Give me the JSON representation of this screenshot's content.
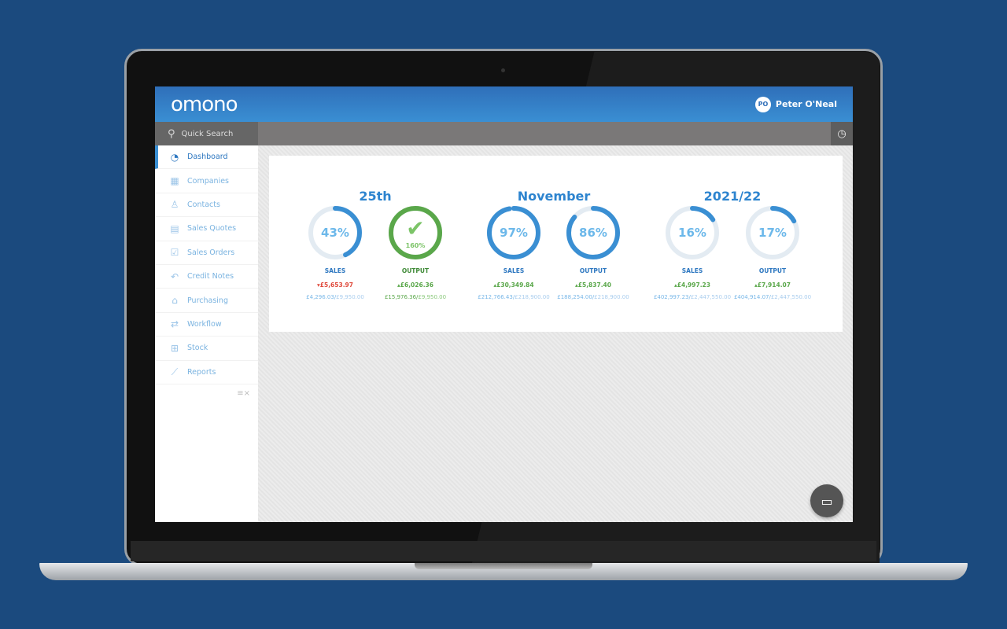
{
  "brand": {
    "logo": "omono"
  },
  "user": {
    "initials": "PO",
    "name": "Peter O'Neal"
  },
  "search": {
    "label": "Quick Search"
  },
  "sidebar": {
    "items": [
      {
        "label": "Dashboard",
        "icon": "◔",
        "active": true
      },
      {
        "label": "Companies",
        "icon": "▦"
      },
      {
        "label": "Contacts",
        "icon": "♙"
      },
      {
        "label": "Sales Quotes",
        "icon": "▤"
      },
      {
        "label": "Sales Orders",
        "icon": "☑"
      },
      {
        "label": "Credit Notes",
        "icon": "↶"
      },
      {
        "label": "Purchasing",
        "icon": "⌂"
      },
      {
        "label": "Workflow",
        "icon": "⇄"
      },
      {
        "label": "Stock",
        "icon": "⊞"
      },
      {
        "label": "Reports",
        "icon": "⟋"
      }
    ]
  },
  "colors": {
    "blue": "#3a8fd3",
    "lightblue": "#6cb8ea",
    "green": "#5aa74a",
    "red": "#e04a3c",
    "track": "#e3ebf2"
  },
  "groups": [
    {
      "title": "25th",
      "gauges": [
        {
          "label": "SALES",
          "percent": 43,
          "display": "43%",
          "delta": "£5,653.97",
          "direction": "down",
          "actual": "£4,296.03",
          "target": "£9,950.00"
        },
        {
          "label": "OUTPUT",
          "percent": 160,
          "display": "160%",
          "complete": true,
          "delta": "£6,026.36",
          "direction": "up",
          "actual": "£15,976.36",
          "target": "£9,950.00"
        }
      ]
    },
    {
      "title": "November",
      "gauges": [
        {
          "label": "SALES",
          "percent": 97,
          "display": "97%",
          "delta": "£30,349.84",
          "direction": "up",
          "actual": "£212,766.43",
          "target": "£218,900.00"
        },
        {
          "label": "OUTPUT",
          "percent": 86,
          "display": "86%",
          "delta": "£5,837.40",
          "direction": "up",
          "actual": "£188,254.00",
          "target": "£218,900.00"
        }
      ]
    },
    {
      "title": "2021/22",
      "gauges": [
        {
          "label": "SALES",
          "percent": 16,
          "display": "16%",
          "delta": "£4,997.23",
          "direction": "up",
          "actual": "£402,997.23",
          "target": "£2,447,550.00"
        },
        {
          "label": "OUTPUT",
          "percent": 17,
          "display": "17%",
          "delta": "£7,914.07",
          "direction": "up",
          "actual": "£404,914.07",
          "target": "£2,447,550.00"
        }
      ]
    }
  ]
}
